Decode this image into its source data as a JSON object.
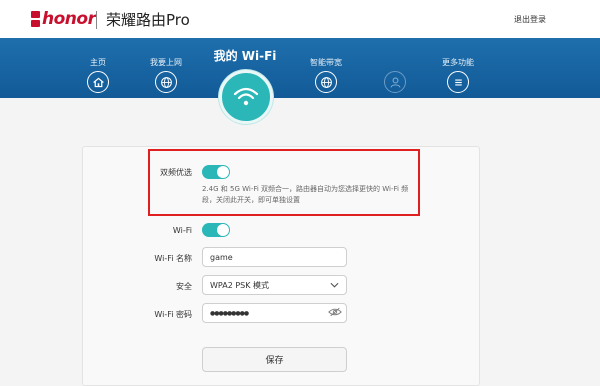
{
  "header": {
    "brand_small": "荣耀",
    "brand": "honor",
    "title": "荣耀路由Pro",
    "logout": "退出登录"
  },
  "nav": {
    "items": [
      {
        "label": "主页",
        "icon": "home-icon"
      },
      {
        "label": "我要上网",
        "icon": "globe-icon"
      },
      {
        "label": "智能带宽",
        "icon": "globe-icon"
      },
      {
        "label": "",
        "icon": "user-icon"
      },
      {
        "label": "更多功能",
        "icon": "menu-icon"
      }
    ],
    "active": {
      "label": "我的 Wi-Fi",
      "icon": "wifi-icon"
    }
  },
  "form": {
    "dual_band": {
      "label": "双频优选",
      "enabled": true,
      "description": "2.4G 和 5G Wi-Fi 双频合一，路由器自动为您选择更快的 Wi-Fi 频段，关闭此开关，即可单独设置"
    },
    "wifi": {
      "label": "Wi-Fi",
      "enabled": true
    },
    "ssid": {
      "label": "Wi-Fi 名称",
      "value": "game"
    },
    "security": {
      "label": "安全",
      "value": "WPA2 PSK 模式"
    },
    "password": {
      "label": "Wi-Fi 密码",
      "value": "●●●●●●●●●"
    },
    "save_label": "保存"
  },
  "colors": {
    "accent": "#2bb7b8",
    "nav_bg": "#1a67a5",
    "brand_red": "#c8102e",
    "highlight": "#e02020"
  }
}
